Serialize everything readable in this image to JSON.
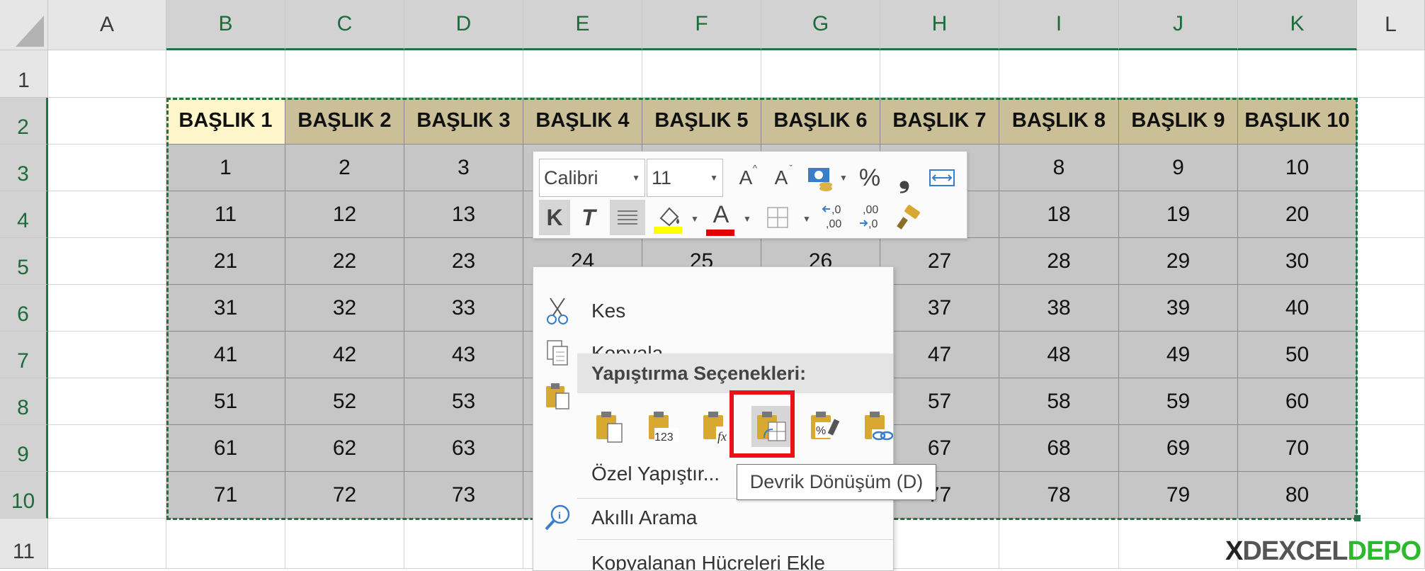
{
  "columns": [
    "A",
    "B",
    "C",
    "D",
    "E",
    "F",
    "G",
    "H",
    "I",
    "J",
    "K",
    "L"
  ],
  "rows": [
    "1",
    "2",
    "3",
    "4",
    "5",
    "6",
    "7",
    "8",
    "9",
    "10",
    "11"
  ],
  "headers": [
    "BAŞLIK 1",
    "BAŞLIK 2",
    "BAŞLIK 3",
    "BAŞLIK 4",
    "BAŞLIK 5",
    "BAŞLIK 6",
    "BAŞLIK 7",
    "BAŞLIK 8",
    "BAŞLIK 9",
    "BAŞLIK 10"
  ],
  "data": [
    [
      "1",
      "2",
      "3",
      "",
      "",
      "",
      "",
      "8",
      "9",
      "10"
    ],
    [
      "11",
      "12",
      "13",
      "",
      "",
      "",
      "",
      "18",
      "19",
      "20"
    ],
    [
      "21",
      "22",
      "23",
      "24",
      "25",
      "26",
      "27",
      "28",
      "29",
      "30"
    ],
    [
      "31",
      "32",
      "33",
      "",
      "",
      "",
      "37",
      "38",
      "39",
      "40"
    ],
    [
      "41",
      "42",
      "43",
      "",
      "",
      "",
      "47",
      "48",
      "49",
      "50"
    ],
    [
      "51",
      "52",
      "53",
      "",
      "",
      "",
      "57",
      "58",
      "59",
      "60"
    ],
    [
      "61",
      "62",
      "63",
      "",
      "",
      "",
      "67",
      "68",
      "69",
      "70"
    ],
    [
      "71",
      "72",
      "73",
      "",
      "",
      "",
      "77",
      "78",
      "79",
      "80"
    ]
  ],
  "mini_toolbar": {
    "font_name": "Calibri",
    "font_size": "11",
    "percent": "%",
    "comma": "❟",
    "bold": "K",
    "italic": "T",
    "font_color_letter": "A",
    "grow_font": "A",
    "shrink_font": "A",
    "decimals_increase": "←,0\n,00",
    "decimals_decrease": ",00\n→,0",
    "highlight_color": "#ffff00",
    "font_color": "#e00000"
  },
  "context_menu": {
    "cut": "Kes",
    "copy": "Kopyala",
    "paste_options_header": "Yapıştırma Seçenekleri:",
    "paste_special": "Özel Yapıştır...",
    "smart_lookup": "Akıllı Arama",
    "insert_copied": "Kopyalanan Hücreleri Ekle",
    "paste_buttons": [
      "paste",
      "values",
      "formulas",
      "transpose",
      "formatting",
      "paste-link"
    ],
    "paste_values_label": "123",
    "paste_formulas_label": "fx"
  },
  "tooltip": "Devrik Dönüşüm (D)",
  "logo": {
    "text_x": "X",
    "text_main": "DEXCEL",
    "text_depo": "DEPO",
    "accent": "#2eb82e"
  },
  "colors": {
    "excel_green": "#217346",
    "highlight_red": "#e8121a"
  }
}
